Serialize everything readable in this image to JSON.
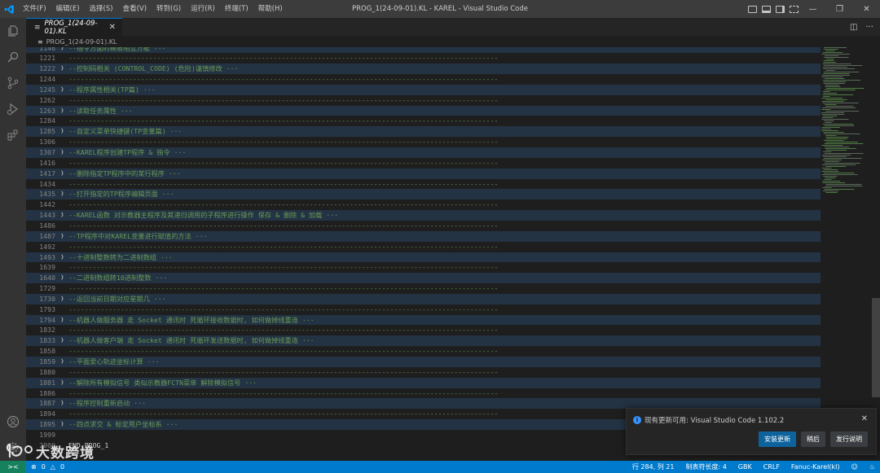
{
  "window": {
    "title": "PROG_1(24-09-01).KL - KAREL - Visual Studio Code",
    "menu": [
      "文件(F)",
      "编辑(E)",
      "选择(S)",
      "查看(V)",
      "转到(G)",
      "运行(R)",
      "终端(T)",
      "帮助(H)"
    ]
  },
  "tab": {
    "label": "PROG_1(24-09-01).KL"
  },
  "breadcrumb": {
    "file": "PROG_1(24-09-01).KL"
  },
  "editor": {
    "lines": [
      {
        "n": "1146",
        "text": "--指令方面的模板相互方能 ···",
        "type": "fold"
      },
      {
        "n": "1221",
        "text": "-----------------------------------------------------------------------------------------------------------",
        "type": "dash"
      },
      {
        "n": "1222",
        "text": "--控制码相关 (CONTROL_CODE) (危险)谨慎修改 ···",
        "type": "fold"
      },
      {
        "n": "1244",
        "text": "-----------------------------------------------------------------------------------------------------------",
        "type": "dash"
      },
      {
        "n": "1245",
        "text": "--程序属性相关(TP篇) ···",
        "type": "fold"
      },
      {
        "n": "1262",
        "text": "-----------------------------------------------------------------------------------------------------------",
        "type": "dash"
      },
      {
        "n": "1263",
        "text": "--读取任务属性 ···",
        "type": "fold"
      },
      {
        "n": "1284",
        "text": "-----------------------------------------------------------------------------------------------------------",
        "type": "dash"
      },
      {
        "n": "1285",
        "text": "--自定义菜单快捷键(TP变量篇) ···",
        "type": "fold"
      },
      {
        "n": "1306",
        "text": "-----------------------------------------------------------------------------------------------------------",
        "type": "dash"
      },
      {
        "n": "1307",
        "text": "--KAREL程序创建TP程序 & 指令 ···",
        "type": "fold"
      },
      {
        "n": "1416",
        "text": "-----------------------------------------------------------------------------------------------------------",
        "type": "dash"
      },
      {
        "n": "1417",
        "text": "--删除指定TP程序中的某行程序 ···",
        "type": "fold"
      },
      {
        "n": "1434",
        "text": "-----------------------------------------------------------------------------------------------------------",
        "type": "dash"
      },
      {
        "n": "1435",
        "text": "--打开指定的TP程序编辑页面 ···",
        "type": "fold"
      },
      {
        "n": "1442",
        "text": "-----------------------------------------------------------------------------------------------------------",
        "type": "dash"
      },
      {
        "n": "1443",
        "text": "--KAREL函数 对示教器主程序及其递归调用的子程序进行操作 保存 & 删除 & 加载 ···",
        "type": "fold"
      },
      {
        "n": "1486",
        "text": "-----------------------------------------------------------------------------------------------------------",
        "type": "dash"
      },
      {
        "n": "1487",
        "text": "--TP程序中对KAREL变量进行赋值的方法 ···",
        "type": "fold"
      },
      {
        "n": "1492",
        "text": "-----------------------------------------------------------------------------------------------------------",
        "type": "dash"
      },
      {
        "n": "1493",
        "text": "--十进制整数转为二进制数组 ···",
        "type": "fold"
      },
      {
        "n": "1639",
        "text": "-----------------------------------------------------------------------------------------------------------",
        "type": "dash"
      },
      {
        "n": "1640",
        "text": "--二进制数组转10进制整数 ···",
        "type": "fold"
      },
      {
        "n": "1729",
        "text": "-----------------------------------------------------------------------------------------------------------",
        "type": "dash"
      },
      {
        "n": "1730",
        "text": "--返回当前日期对应星期几 ···",
        "type": "fold"
      },
      {
        "n": "1793",
        "text": "-----------------------------------------------------------------------------------------------------------",
        "type": "dash"
      },
      {
        "n": "1794",
        "text": "--机器人做服务器 走 Socket 通讯时  死循环接收数据时, 如何做掉线重连 ···",
        "type": "fold"
      },
      {
        "n": "1832",
        "text": "-----------------------------------------------------------------------------------------------------------",
        "type": "dash"
      },
      {
        "n": "1833",
        "text": "--机器人做客户端 走 Socket 通讯时  死循环发送数据时, 如何做掉线重连 ···",
        "type": "fold"
      },
      {
        "n": "1858",
        "text": "-----------------------------------------------------------------------------------------------------------",
        "type": "dash"
      },
      {
        "n": "1859",
        "text": "--平面爱心轨迹坐标计算 ···",
        "type": "fold"
      },
      {
        "n": "1880",
        "text": "-----------------------------------------------------------------------------------------------------------",
        "type": "dash"
      },
      {
        "n": "1881",
        "text": "--解除所有模拟信号 类似示教器FCTN菜单 解除模拟信号 ···",
        "type": "fold"
      },
      {
        "n": "1886",
        "text": "-----------------------------------------------------------------------------------------------------------",
        "type": "dash"
      },
      {
        "n": "1887",
        "text": "--程序控制重新启动  ···",
        "type": "fold"
      },
      {
        "n": "1894",
        "text": "-----------------------------------------------------------------------------------------------------------",
        "type": "dash"
      },
      {
        "n": "1895",
        "text": "--四点求交 & 标定用户坐标系 ···",
        "type": "fold"
      },
      {
        "n": "1999",
        "text": "",
        "type": "blank"
      },
      {
        "n": "2000",
        "text": "END PROG_1",
        "type": "kw"
      }
    ]
  },
  "notification": {
    "message": "现有更新可用: Visual Studio Code 1.102.2",
    "buttons": [
      "安装更新",
      "稍后",
      "发行说明"
    ]
  },
  "status": {
    "errors": "0",
    "warnings": "0",
    "position": "行 284, 列 21",
    "tab_size": "制表符长度: 4",
    "encoding": "GBK",
    "eol": "CRLF",
    "language": "Fanuc-Karel(kl)"
  },
  "watermark": {
    "text": "大数跨境"
  },
  "colors": {
    "statusbar": "#007acc",
    "accent": "#0078d4",
    "comment": "#6a9955"
  }
}
